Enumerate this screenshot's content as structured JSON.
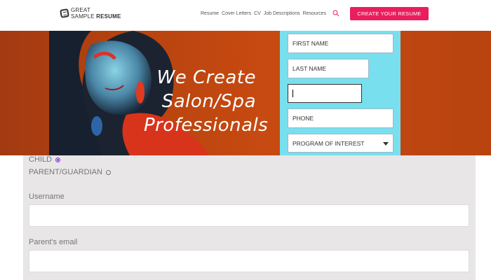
{
  "header": {
    "logo": {
      "line1": "GREAT",
      "line2a": "SAMPLE",
      "line2b": "RESUME"
    },
    "nav": [
      "Resume",
      "Cover Letters",
      "CV",
      "Job Descriptions",
      "Resources"
    ],
    "search_icon": "search-icon",
    "cta_label": "CREATE YOUR RESUME",
    "accent": "#ea1d5d"
  },
  "hero": {
    "tagline": [
      "We Create",
      "Salon/Spa",
      "Professionals"
    ],
    "bg_color": "#c74a11"
  },
  "form": {
    "panel_color": "#78dfef",
    "first_name_placeholder": "FIRST NAME",
    "last_name_placeholder": "LAST NAME",
    "phone_placeholder": "PHONE",
    "program_label": "PROGRAM OF INTEREST"
  },
  "account": {
    "child_label": "CHILD",
    "parent_label": "PARENT/GUARDIAN",
    "selected": "CHILD",
    "username_label": "Username",
    "parent_email_label": "Parent's email"
  }
}
